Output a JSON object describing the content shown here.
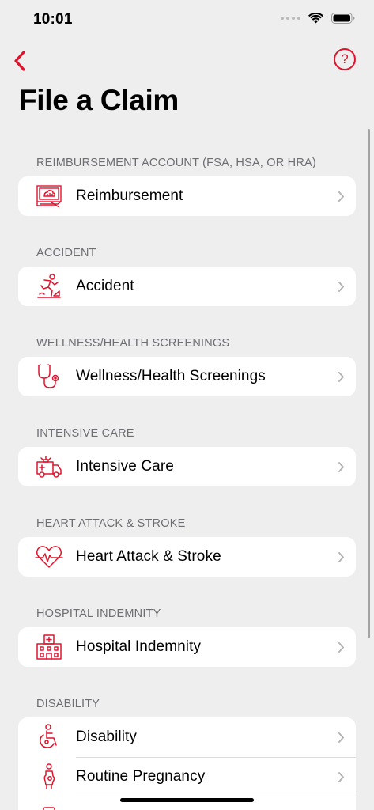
{
  "status": {
    "time": "10:01"
  },
  "nav": {
    "help_glyph": "?"
  },
  "page": {
    "title": "File a Claim"
  },
  "accent_color": "#e0132d",
  "sections": [
    {
      "header": "REIMBURSEMENT ACCOUNT (FSA, HSA, OR HRA)",
      "items": [
        {
          "label": "Reimbursement",
          "icon": "reimbursement-icon"
        }
      ]
    },
    {
      "header": "ACCIDENT",
      "items": [
        {
          "label": "Accident",
          "icon": "accident-icon"
        }
      ]
    },
    {
      "header": "WELLNESS/HEALTH SCREENINGS",
      "items": [
        {
          "label": "Wellness/Health Screenings",
          "icon": "stethoscope-icon"
        }
      ]
    },
    {
      "header": "INTENSIVE CARE",
      "items": [
        {
          "label": "Intensive Care",
          "icon": "ambulance-icon"
        }
      ]
    },
    {
      "header": "HEART ATTACK & STROKE",
      "items": [
        {
          "label": "Heart Attack & Stroke",
          "icon": "heart-icon"
        }
      ]
    },
    {
      "header": "HOSPITAL INDEMNITY",
      "items": [
        {
          "label": "Hospital Indemnity",
          "icon": "hospital-icon"
        }
      ]
    },
    {
      "header": "DISABILITY",
      "items": [
        {
          "label": "Disability",
          "icon": "wheelchair-icon"
        },
        {
          "label": "Routine Pregnancy",
          "icon": "pregnancy-icon"
        }
      ]
    }
  ]
}
